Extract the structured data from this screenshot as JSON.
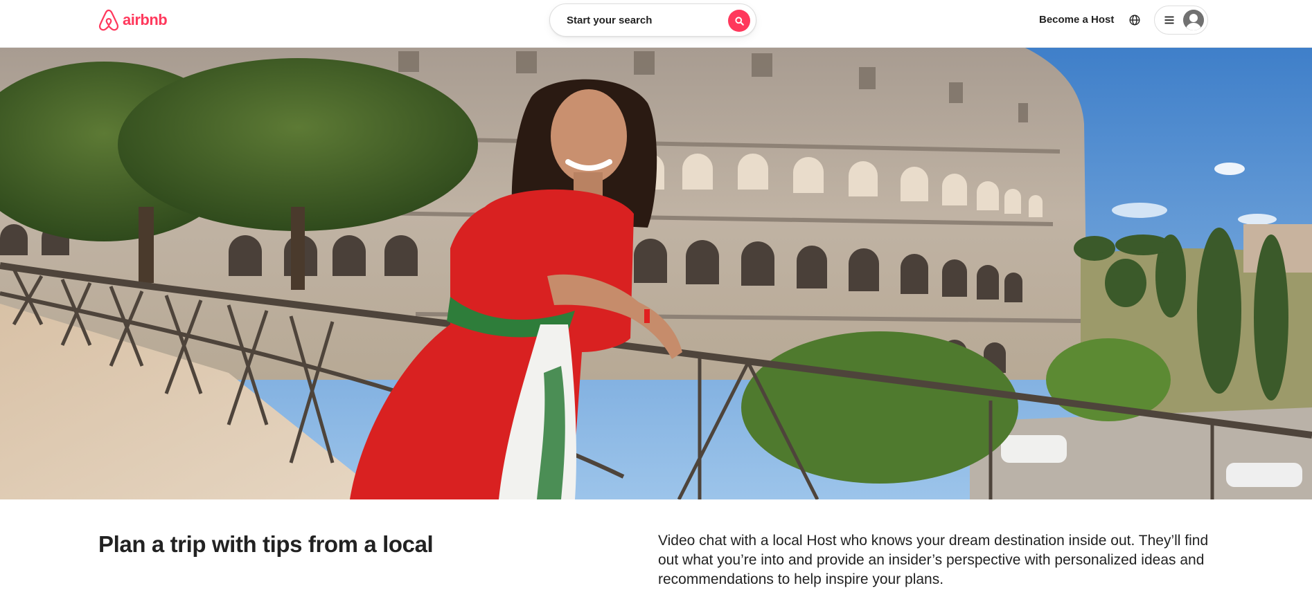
{
  "header": {
    "logo_text": "airbnb",
    "brand_color": "#FF385C",
    "search": {
      "label": "Start your search",
      "icon": "search-icon"
    },
    "become_host_label": "Become a Host",
    "globe_icon": "globe-icon",
    "menu_icon": "hamburger-menu-icon",
    "avatar_icon": "user-avatar-icon"
  },
  "hero": {
    "image_subject": "Host leaning on railing in front of the Colosseum"
  },
  "content": {
    "headline": "Plan a trip with tips from a local",
    "description": "Video chat with a local Host who knows your dream destination inside out. They’ll find out what you’re into and provide an insider’s perspective with personalized ideas and recommendations to help inspire your plans."
  }
}
